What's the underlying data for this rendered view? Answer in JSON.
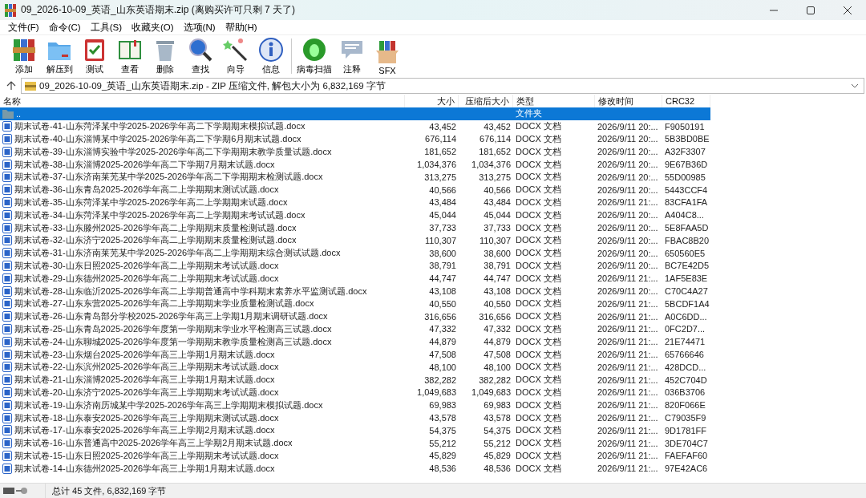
{
  "window": {
    "title": "09_2026-10-09_英语_山东英语期末.zip (离购买许可只剩 7 天了)"
  },
  "menu": [
    "文件(F)",
    "命令(C)",
    "工具(S)",
    "收藏夹(O)",
    "选项(N)",
    "帮助(H)"
  ],
  "toolbar": [
    {
      "kind": "add",
      "label": "添加"
    },
    {
      "kind": "extract",
      "label": "解压到"
    },
    {
      "kind": "test",
      "label": "测试"
    },
    {
      "kind": "view",
      "label": "查看"
    },
    {
      "kind": "delete",
      "label": "删除"
    },
    {
      "kind": "find",
      "label": "查找"
    },
    {
      "kind": "wizard",
      "label": "向导"
    },
    {
      "kind": "info",
      "label": "信息"
    },
    {
      "kind": "virus",
      "label": "病毒扫描"
    },
    {
      "kind": "comment",
      "label": "注释"
    },
    {
      "kind": "sfx",
      "label": "SFX"
    }
  ],
  "address": "09_2026-10-09_英语_山东英语期末.zip - ZIP 压缩文件, 解包大小为 6,832,169 字节",
  "columns": [
    "名称",
    "大小",
    "压缩后大小",
    "类型",
    "修改时间",
    "CRC32"
  ],
  "rows": [
    {
      "kind": "folder",
      "name": "..",
      "size": "",
      "packed": "",
      "type": "文件夹",
      "modified": "",
      "crc": "",
      "selected": true
    },
    {
      "kind": "file",
      "name": "期末试卷-41-山东菏泽某中学2025-2026学年高二下学期期末模拟试题.docx",
      "size": "43,452",
      "packed": "43,452",
      "type": "DOCX 文档",
      "modified": "2026/9/11 20:...",
      "crc": "F9050191",
      "selected": false
    },
    {
      "kind": "file",
      "name": "期末试卷-40-山东淄博某中学2025-2026学年高二下学期6月期末试题.docx",
      "size": "676,114",
      "packed": "676,114",
      "type": "DOCX 文档",
      "modified": "2026/9/11 20:...",
      "crc": "5B3BD0BE",
      "selected": false
    },
    {
      "kind": "file",
      "name": "期末试卷-39-山东淄博实验中学2025-2026学年高二下学期期末教学质量试题.docx",
      "size": "181,652",
      "packed": "181,652",
      "type": "DOCX 文档",
      "modified": "2026/9/11 20:...",
      "crc": "A32F3307",
      "selected": false
    },
    {
      "kind": "file",
      "name": "期末试卷-38-山东淄博2025-2026学年高二下学期7月期末试题.docx",
      "size": "1,034,376",
      "packed": "1,034,376",
      "type": "DOCX 文档",
      "modified": "2026/9/11 20:...",
      "crc": "9E67B36D",
      "selected": false
    },
    {
      "kind": "file",
      "name": "期末试卷-37-山东济南莱芜某中学2025-2026学年高二下学期期末检测试题.docx",
      "size": "313,275",
      "packed": "313,275",
      "type": "DOCX 文档",
      "modified": "2026/9/11 20:...",
      "crc": "55D00985",
      "selected": false
    },
    {
      "kind": "file",
      "name": "期末试卷-36-山东青岛2025-2026学年高二上学期期末测试试题.docx",
      "size": "40,566",
      "packed": "40,566",
      "type": "DOCX 文档",
      "modified": "2026/9/11 20:...",
      "crc": "5443CCF4",
      "selected": false
    },
    {
      "kind": "file",
      "name": "期末试卷-35-山东菏泽某中学2025-2026学年高二上学期期末试题.docx",
      "size": "43,484",
      "packed": "43,484",
      "type": "DOCX 文档",
      "modified": "2026/9/11 21:...",
      "crc": "83CFA1FA",
      "selected": false
    },
    {
      "kind": "file",
      "name": "期末试卷-34-山东菏泽某中学2025-2026学年高二上学期期末考试试题.docx",
      "size": "45,044",
      "packed": "45,044",
      "type": "DOCX 文档",
      "modified": "2026/9/11 20:...",
      "crc": "A404C8...",
      "selected": false
    },
    {
      "kind": "file",
      "name": "期末试卷-33-山东滕州2025-2026学年高二上学期期末质量检测试题.docx",
      "size": "37,733",
      "packed": "37,733",
      "type": "DOCX 文档",
      "modified": "2026/9/11 20:...",
      "crc": "5E8FAA5D",
      "selected": false
    },
    {
      "kind": "file",
      "name": "期末试卷-32-山东济宁2025-2026学年高二上学期期末质量检测试题.docx",
      "size": "110,307",
      "packed": "110,307",
      "type": "DOCX 文档",
      "modified": "2026/9/11 20:...",
      "crc": "FBAC8B20",
      "selected": false
    },
    {
      "kind": "file",
      "name": "期末试卷-31-山东济南莱芜某中学2025-2026学年高二上学期期末综合测试试题.docx",
      "size": "38,600",
      "packed": "38,600",
      "type": "DOCX 文档",
      "modified": "2026/9/11 20:...",
      "crc": "650560E5",
      "selected": false
    },
    {
      "kind": "file",
      "name": "期末试卷-30-山东日照2025-2026学年高二上学期期末考试试题.docx",
      "size": "38,791",
      "packed": "38,791",
      "type": "DOCX 文档",
      "modified": "2026/9/11 20:...",
      "crc": "BC7E42D5",
      "selected": false
    },
    {
      "kind": "file",
      "name": "期末试卷-29-山东德州2025-2026学年高二上学期期末考试试题.docx",
      "size": "44,747",
      "packed": "44,747",
      "type": "DOCX 文档",
      "modified": "2026/9/11 21:...",
      "crc": "1AF5E83E",
      "selected": false
    },
    {
      "kind": "file",
      "name": "期末试卷-28-山东临沂2025-2026学年高二上学期普通高中学科期末素养水平监测试题.docx",
      "size": "43,108",
      "packed": "43,108",
      "type": "DOCX 文档",
      "modified": "2026/9/11 20:...",
      "crc": "C70C4A27",
      "selected": false
    },
    {
      "kind": "file",
      "name": "期末试卷-27-山东东营2025-2026学年高二上学期期末学业质量检测试题.docx",
      "size": "40,550",
      "packed": "40,550",
      "type": "DOCX 文档",
      "modified": "2026/9/11 21:...",
      "crc": "5BCDF1A4",
      "selected": false
    },
    {
      "kind": "file",
      "name": "期末试卷-26-山东青岛部分学校2025-2026学年高三上学期1月期末调研试题.docx",
      "size": "316,656",
      "packed": "316,656",
      "type": "DOCX 文档",
      "modified": "2026/9/11 21:...",
      "crc": "A0C6DD...",
      "selected": false
    },
    {
      "kind": "file",
      "name": "期末试卷-25-山东青岛2025-2026学年度第一学期期末学业水平检测高三试题.docx",
      "size": "47,332",
      "packed": "47,332",
      "type": "DOCX 文档",
      "modified": "2026/9/11 21:...",
      "crc": "0FC2D7...",
      "selected": false
    },
    {
      "kind": "file",
      "name": "期末试卷-24-山东聊城2025-2026学年度第一学期期末教学质量检测高三试题.docx",
      "size": "44,879",
      "packed": "44,879",
      "type": "DOCX 文档",
      "modified": "2026/9/11 21:...",
      "crc": "21E74471",
      "selected": false
    },
    {
      "kind": "file",
      "name": "期末试卷-23-山东烟台2025-2026学年高三上学期1月期末试题.docx",
      "size": "47,508",
      "packed": "47,508",
      "type": "DOCX 文档",
      "modified": "2026/9/11 21:...",
      "crc": "65766646",
      "selected": false
    },
    {
      "kind": "file",
      "name": "期末试卷-22-山东滨州2025-2026学年高三上学期期末考试试题.docx",
      "size": "48,100",
      "packed": "48,100",
      "type": "DOCX 文档",
      "modified": "2026/9/11 21:...",
      "crc": "428DCD...",
      "selected": false
    },
    {
      "kind": "file",
      "name": "期末试卷-21-山东淄博2025-2026学年高三上学期1月期末试题.docx",
      "size": "382,282",
      "packed": "382,282",
      "type": "DOCX 文档",
      "modified": "2026/9/11 21:...",
      "crc": "452C704D",
      "selected": false
    },
    {
      "kind": "file",
      "name": "期末试卷-20-山东济宁2025-2026学年高三上学期期末考试试题.docx",
      "size": "1,049,683",
      "packed": "1,049,683",
      "type": "DOCX 文档",
      "modified": "2026/9/11 21:...",
      "crc": "036B3706",
      "selected": false
    },
    {
      "kind": "file",
      "name": "期末试卷-19-山东济南历城某中学2025-2026学年高三上学期期末模拟试题.docx",
      "size": "69,983",
      "packed": "69,983",
      "type": "DOCX 文档",
      "modified": "2026/9/11 21:...",
      "crc": "820F066E",
      "selected": false
    },
    {
      "kind": "file",
      "name": "期末试卷-18-山东泰安2025-2026学年高三上学期期末测试试题.docx",
      "size": "43,578",
      "packed": "43,578",
      "type": "DOCX 文档",
      "modified": "2026/9/11 21:...",
      "crc": "C79035F9",
      "selected": false
    },
    {
      "kind": "file",
      "name": "期末试卷-17-山东泰安2025-2026学年高三上学期2月期末试题.docx",
      "size": "54,375",
      "packed": "54,375",
      "type": "DOCX 文档",
      "modified": "2026/9/11 21:...",
      "crc": "9D1781FF",
      "selected": false
    },
    {
      "kind": "file",
      "name": "期末试卷-16-山东普通高中2025-2026学年高三上学期2月期末试题.docx",
      "size": "55,212",
      "packed": "55,212",
      "type": "DOCX 文档",
      "modified": "2026/9/11 21:...",
      "crc": "3DE704C7",
      "selected": false
    },
    {
      "kind": "file",
      "name": "期末试卷-15-山东日照2025-2026学年高三上学期期末考试试题.docx",
      "size": "45,829",
      "packed": "45,829",
      "type": "DOCX 文档",
      "modified": "2026/9/11 21:...",
      "crc": "FAEFAF60",
      "selected": false
    },
    {
      "kind": "file",
      "name": "期末试卷-14-山东德州2025-2026学年高三上学期1月期末试题.docx",
      "size": "48,536",
      "packed": "48,536",
      "type": "DOCX 文档",
      "modified": "2026/9/11 21:...",
      "crc": "97E42AC6",
      "selected": false
    }
  ],
  "status_bar": "总计 45 文件, 6,832,169 字节"
}
